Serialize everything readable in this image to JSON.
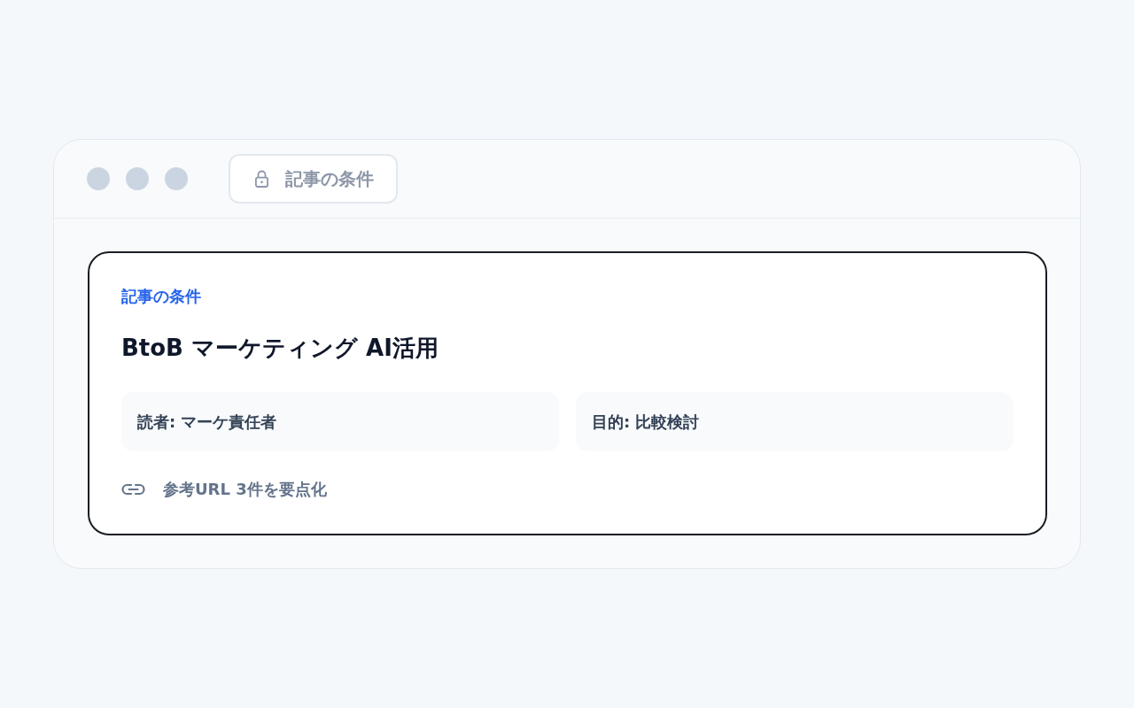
{
  "window": {
    "address_bar": {
      "text": "記事の条件"
    }
  },
  "card": {
    "label": "記事の条件",
    "title": "BtoB マーケティング AI活用",
    "facts": [
      "読者: マーケ責任者",
      "目的: 比較検討"
    ],
    "link": {
      "text": "参考URL 3件を要点化"
    }
  }
}
